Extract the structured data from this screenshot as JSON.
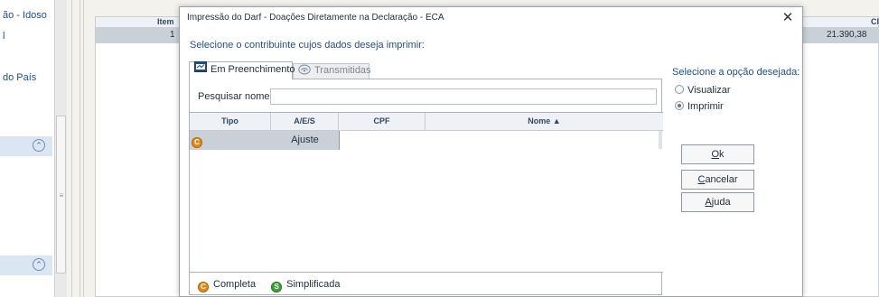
{
  "background": {
    "left_panel_items": [
      "ão - Idoso",
      "l",
      "do País"
    ],
    "table": {
      "col_item": "Item",
      "col_right": "Cl",
      "row_item": "1",
      "row_value": "21.390,38"
    }
  },
  "dialog": {
    "title": "Impressão do Darf - Doações Diretamente na Declaração - ECA",
    "close": "✕",
    "subtitle": "Selecione o contribuinte cujos dados deseja imprimir:",
    "tabs": [
      {
        "label": "Em Preenchimento",
        "icon": "form-icon",
        "active": true
      },
      {
        "label": "Transmitidas",
        "icon": "transmit-icon",
        "active": false
      }
    ],
    "search": {
      "label": "Pesquisar nome:",
      "value": ""
    },
    "grid": {
      "columns": [
        "Tipo",
        "A/E/S",
        "CPF",
        "Nome ▲"
      ],
      "rows": [
        {
          "tipo_icon": "C",
          "aes": "Ajuste",
          "cpf": "",
          "nome": ""
        }
      ]
    },
    "legend": [
      {
        "icon": "C",
        "label": "Completa",
        "color": "#e38a16"
      },
      {
        "icon": "S",
        "label": "Simplificada",
        "color": "#3ea23a"
      }
    ],
    "options": {
      "label": "Selecione a opção desejada:",
      "items": [
        {
          "label": "Visualizar",
          "selected": false
        },
        {
          "label": "Imprimir",
          "selected": true
        }
      ]
    },
    "buttons": {
      "ok": {
        "mnemonic": "O",
        "rest": "k"
      },
      "cancel": {
        "mnemonic": "C",
        "rest": "ancelar"
      },
      "help": {
        "mnemonic": "A",
        "rest": "juda"
      }
    }
  },
  "colors": {
    "accent_text": "#1d4f91",
    "selection_band": "#dbe6f3",
    "row_highlight": "#c9d0d8"
  }
}
